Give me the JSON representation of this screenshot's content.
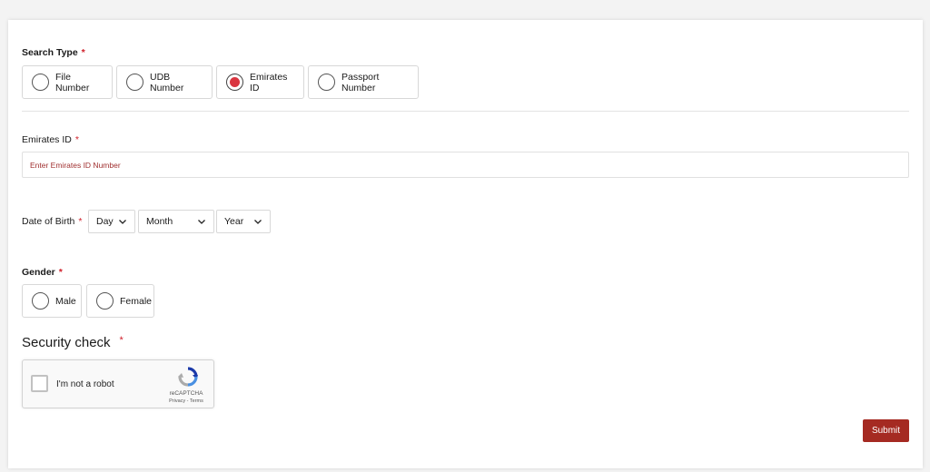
{
  "form": {
    "search_type": {
      "label": "Search Type",
      "required_mark": "*",
      "options": [
        {
          "label": "File Number",
          "checked": false
        },
        {
          "label": "UDB Number",
          "checked": false
        },
        {
          "label": "Emirates ID",
          "checked": true
        },
        {
          "label": "Passport Number",
          "checked": false
        }
      ]
    },
    "emirates_id": {
      "label": "Emirates ID",
      "required_mark": "*",
      "value": "",
      "placeholder": "Enter Emirates ID Number"
    },
    "date_of_birth": {
      "label": "Date of Birth",
      "required_mark": "*",
      "day": "Day",
      "month": "Month",
      "year": "Year"
    },
    "gender": {
      "label": "Gender",
      "required_mark": "*",
      "options": [
        {
          "label": "Male",
          "checked": false
        },
        {
          "label": "Female",
          "checked": false
        }
      ]
    },
    "security_check": {
      "label": "Security check",
      "required_mark": "*",
      "captcha_label": "I'm not a robot",
      "captcha_brand": "reCAPTCHA",
      "captcha_links": "Privacy - Terms"
    },
    "submit_label": "Submit"
  },
  "colors": {
    "accent": "#a52a22",
    "radio_selected": "#d93540",
    "required": "#d0202b"
  },
  "icons": {
    "chevron": "chevron-down-icon",
    "captcha_logo": "recaptcha-logo-icon"
  }
}
